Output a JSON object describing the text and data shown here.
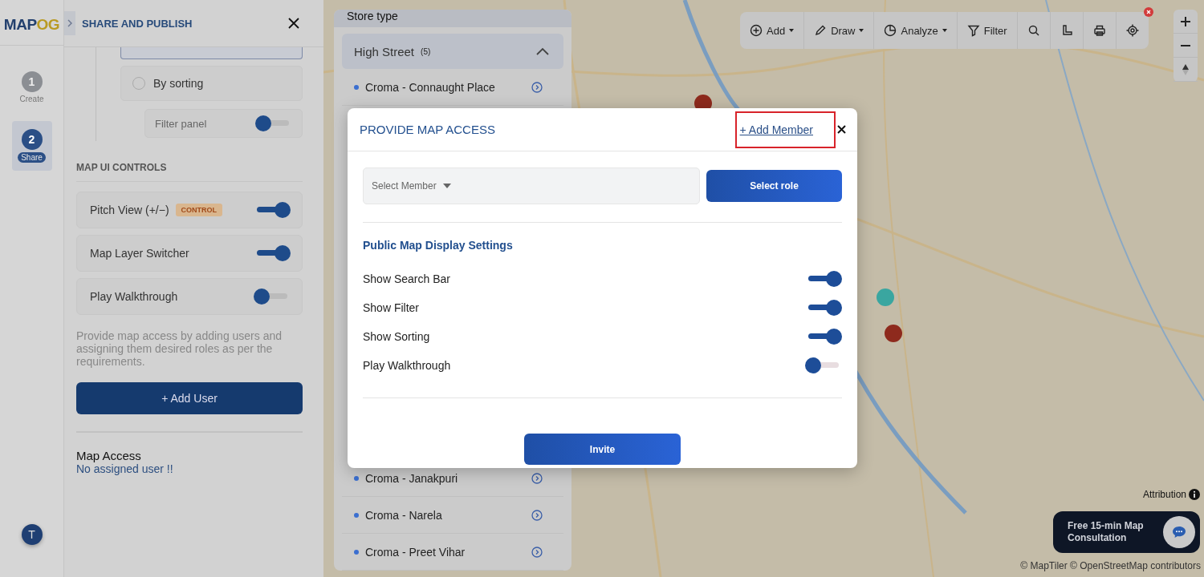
{
  "rail": {
    "logo_main": "MAP",
    "logo_accent": "OG",
    "steps": [
      {
        "number": "1",
        "label": "Create",
        "selected": false
      },
      {
        "number": "2",
        "label": "Share",
        "selected": true
      }
    ],
    "avatar": "T"
  },
  "panel": {
    "title": "SHARE AND PUBLISH",
    "sort_option": {
      "label": "By sorting",
      "selected": false
    },
    "filter_panel": {
      "label": "Filter panel",
      "on": false
    },
    "section_title": "MAP UI CONTROLS",
    "controls": [
      {
        "label": "Pitch View (+/−)",
        "badge": "CONTROL",
        "on": true
      },
      {
        "label": "Map Layer Switcher",
        "on": true
      },
      {
        "label": "Play Walkthrough",
        "on": false
      }
    ],
    "description": "Provide map access by adding users and assigning them desired roles as per the requirements.",
    "add_button": "+ Add User",
    "access_title": "Map Access",
    "access_status": "No assigned user !!"
  },
  "store_list": {
    "title": "Store type",
    "group": {
      "label": "High Street",
      "count": "(5)",
      "expanded": true
    },
    "stores_above": [
      {
        "name": "Croma - Connaught Place"
      }
    ],
    "stores_below": [
      {
        "name": "Croma - Janakpuri"
      },
      {
        "name": "Croma - Narela"
      },
      {
        "name": "Croma - Preet Vihar"
      }
    ]
  },
  "toolbar": {
    "tools": [
      {
        "kind": "add",
        "label": "Add",
        "dropdown": true
      },
      {
        "kind": "draw",
        "label": "Draw",
        "dropdown": true
      },
      {
        "kind": "analyze",
        "label": "Analyze",
        "dropdown": true
      },
      {
        "kind": "filter",
        "label": "Filter",
        "dropdown": false
      },
      {
        "kind": "search",
        "dropdown": false
      },
      {
        "kind": "measure",
        "dropdown": false
      },
      {
        "kind": "print",
        "dropdown": false
      },
      {
        "kind": "locate",
        "dropdown": false
      }
    ]
  },
  "modal": {
    "title": "PROVIDE MAP ACCESS",
    "add_member": "+ Add Member",
    "member_placeholder": "Select Member",
    "role_button": "Select role",
    "settings_title": "Public Map Display Settings",
    "settings": [
      {
        "label": "Show Search Bar",
        "on": true
      },
      {
        "label": "Show Filter",
        "on": true
      },
      {
        "label": "Show Sorting",
        "on": true
      },
      {
        "label": "Play Walkthrough",
        "on": false
      }
    ],
    "invite": "Invite"
  },
  "chat": {
    "text": "Free 15-min Map Consultation"
  },
  "attribution": {
    "label": "Attribution",
    "credits": "© MapTiler © OpenStreetMap contributors"
  }
}
